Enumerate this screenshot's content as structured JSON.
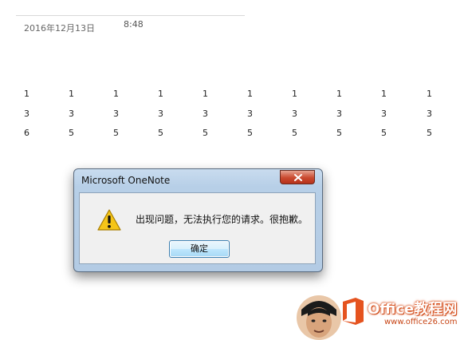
{
  "page": {
    "date": "2016年12月13日",
    "time": "8:48"
  },
  "table": {
    "rows": [
      [
        "1",
        "1",
        "1",
        "1",
        "1",
        "1",
        "1",
        "1",
        "1",
        "1"
      ],
      [
        "3",
        "3",
        "3",
        "3",
        "3",
        "3",
        "3",
        "3",
        "3",
        "3"
      ],
      [
        "6",
        "5",
        "5",
        "5",
        "5",
        "5",
        "5",
        "5",
        "5",
        "5"
      ]
    ]
  },
  "dialog": {
    "title": "Microsoft OneNote",
    "message": "出现问题，无法执行您的请求。很抱歉。",
    "ok_label": "确定",
    "icon": "warning-icon",
    "close_icon": "close-icon"
  },
  "watermark": {
    "brand": "Office教程网",
    "url": "www.office26.com"
  },
  "colors": {
    "title_bar": "#b7cfe7",
    "close_button": "#c9492f",
    "brand_orange": "#d9521f"
  }
}
